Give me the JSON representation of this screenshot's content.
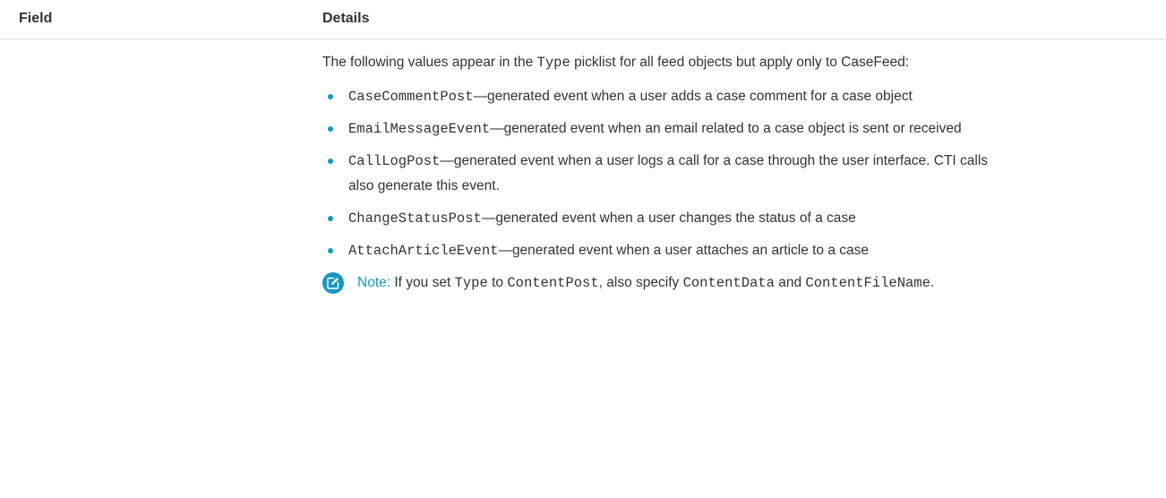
{
  "table": {
    "headers": {
      "field": "Field",
      "details": "Details"
    }
  },
  "details": {
    "intro": {
      "before": "The following values appear in the ",
      "code": "Type",
      "after": " picklist for all feed objects but apply only to CaseFeed:"
    },
    "items": [
      {
        "code": "CaseCommentPost",
        "text": "—generated event when a user adds a case comment for a case object"
      },
      {
        "code": "EmailMessageEvent",
        "text": "—generated event when an email related to a case object is sent or received"
      },
      {
        "code": "CallLogPost",
        "text": "—generated event when a user logs a call for a case through the user interface. CTI calls also generate this event."
      },
      {
        "code": "ChangeStatusPost",
        "text": "—generated event when a user changes the status of a case"
      },
      {
        "code": "AttachArticleEvent",
        "text": "—generated event when a user attaches an article to a case"
      }
    ],
    "note": {
      "icon": "edit-note-icon",
      "label": "Note:",
      "text1": " If you set ",
      "code1": "Type",
      "text2": " to ",
      "code2": "ContentPost",
      "text3": ", also specify ",
      "code3": "ContentData",
      "text4": " and ",
      "code4": "ContentFileName",
      "text5": "."
    }
  },
  "colors": {
    "accent": "#1797c0",
    "text": "#333333",
    "divider": "#d8dde6"
  }
}
